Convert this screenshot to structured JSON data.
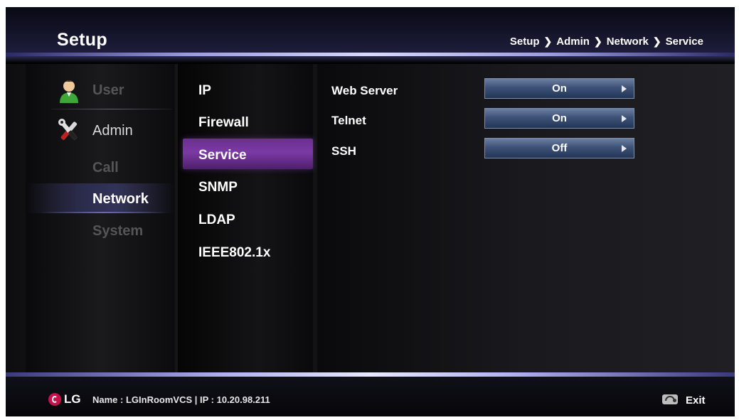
{
  "header": {
    "title": "Setup",
    "breadcrumb": [
      "Setup",
      "Admin",
      "Network",
      "Service"
    ],
    "separator": "❯"
  },
  "categories": {
    "user": {
      "label": "User",
      "icon": "user-icon"
    },
    "admin": {
      "label": "Admin",
      "icon": "tools-icon"
    }
  },
  "admin_submenu": {
    "call": "Call",
    "network": "Network",
    "system": "System"
  },
  "network_menu": {
    "ip": "IP",
    "firewall": "Firewall",
    "service": "Service",
    "snmp": "SNMP",
    "ldap": "LDAP",
    "ieee": "IEEE802.1x"
  },
  "service_settings": [
    {
      "label": "Web Server",
      "value": "On"
    },
    {
      "label": "Telnet",
      "value": "On"
    },
    {
      "label": "SSH",
      "value": "Off"
    }
  ],
  "footer": {
    "brand": "LG",
    "device_info": "Name : LGInRoomVCS  |  IP : 10.20.98.211",
    "exit_label": "Exit"
  },
  "colors": {
    "selected_menu": "#7b3aa4",
    "select_button": "#3e5278",
    "lg_brand": "#c8104a"
  }
}
